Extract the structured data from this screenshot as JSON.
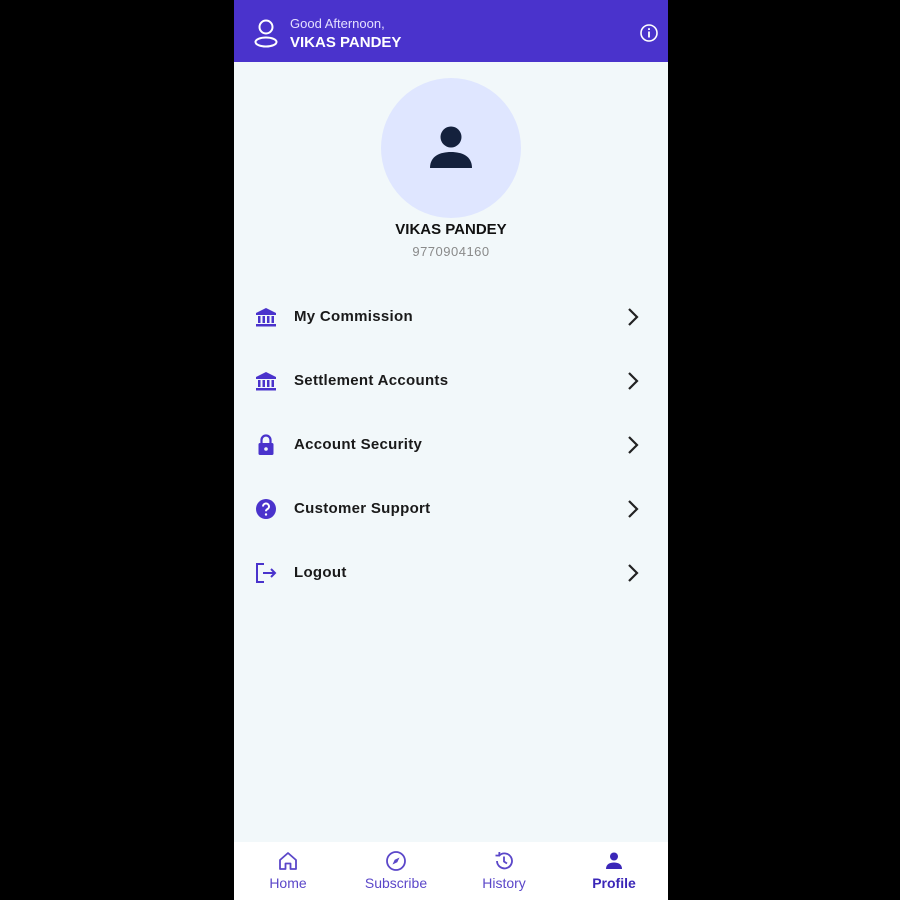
{
  "header": {
    "greeting": "Good Afternoon,",
    "username": "VIKAS PANDEY",
    "user_icon": "user-outline-icon",
    "info_icon": "info-icon"
  },
  "profile": {
    "name": "VIKAS PANDEY",
    "phone": "9770904160",
    "avatar_icon": "person-icon"
  },
  "menu": {
    "items": [
      {
        "label": "My Commission",
        "icon": "bank-icon"
      },
      {
        "label": "Settlement Accounts",
        "icon": "bank-icon"
      },
      {
        "label": "Account Security",
        "icon": "lock-icon"
      },
      {
        "label": "Customer Support",
        "icon": "help-icon"
      },
      {
        "label": "Logout",
        "icon": "logout-icon"
      }
    ]
  },
  "bottom_nav": {
    "items": [
      {
        "label": "Home",
        "icon": "home-icon"
      },
      {
        "label": "Subscribe",
        "icon": "compass-icon"
      },
      {
        "label": "History",
        "icon": "history-icon"
      },
      {
        "label": "Profile",
        "icon": "person-icon",
        "active": true
      }
    ]
  },
  "colors": {
    "brand": "#4a33cc",
    "background": "#f2f8fa",
    "avatar_bg": "#dfe6ff",
    "icon_accent": "#4a33cc"
  }
}
